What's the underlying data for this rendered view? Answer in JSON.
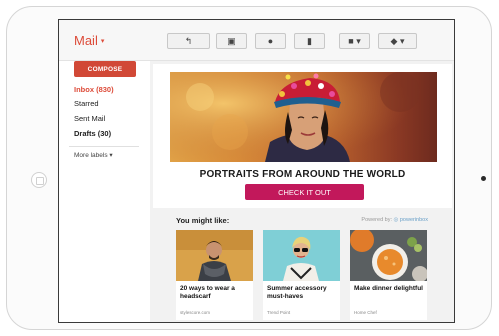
{
  "app": {
    "title": "Mail",
    "title_caret": "▾"
  },
  "toolbar": [
    {
      "name": "reply-button",
      "icon": "reply-icon",
      "glyph": "↰"
    },
    {
      "name": "archive-button",
      "icon": "archive-icon",
      "glyph": "▣"
    },
    {
      "name": "report-spam-button",
      "icon": "alert-icon",
      "glyph": "●"
    },
    {
      "name": "delete-button",
      "icon": "trash-icon",
      "glyph": "▮"
    },
    {
      "name": "move-to-button",
      "icon": "folder-icon",
      "glyph": "■ ▾"
    },
    {
      "name": "labels-button",
      "icon": "tag-icon",
      "glyph": "◆ ▾"
    }
  ],
  "sidebar": {
    "compose_label": "COMPOSE",
    "items": [
      {
        "label": "Inbox (830)"
      },
      {
        "label": "Starred"
      },
      {
        "label": "Sent Mail"
      },
      {
        "label": "Drafts (30)"
      }
    ],
    "more_label": "More labels",
    "more_caret": "▾"
  },
  "email": {
    "headline": "PORTRAITS FROM AROUND THE WORLD",
    "cta_label": "CHECK IT OUT"
  },
  "recommendations": {
    "title": "You might like:",
    "powered_prefix": "Powered by:",
    "powered_brand": "◎ powerinbox",
    "items": [
      {
        "title": "20 ways to wear a headscarf",
        "source": "stylescore.com"
      },
      {
        "title": "Summer accessory must-haves",
        "source": "Trend Point"
      },
      {
        "title": "Make dinner delightful",
        "source": "Home Chef"
      }
    ]
  },
  "colors": {
    "brand_red": "#dd4b39",
    "compose_red": "#d14836",
    "cta_pink": "#c2185b"
  }
}
